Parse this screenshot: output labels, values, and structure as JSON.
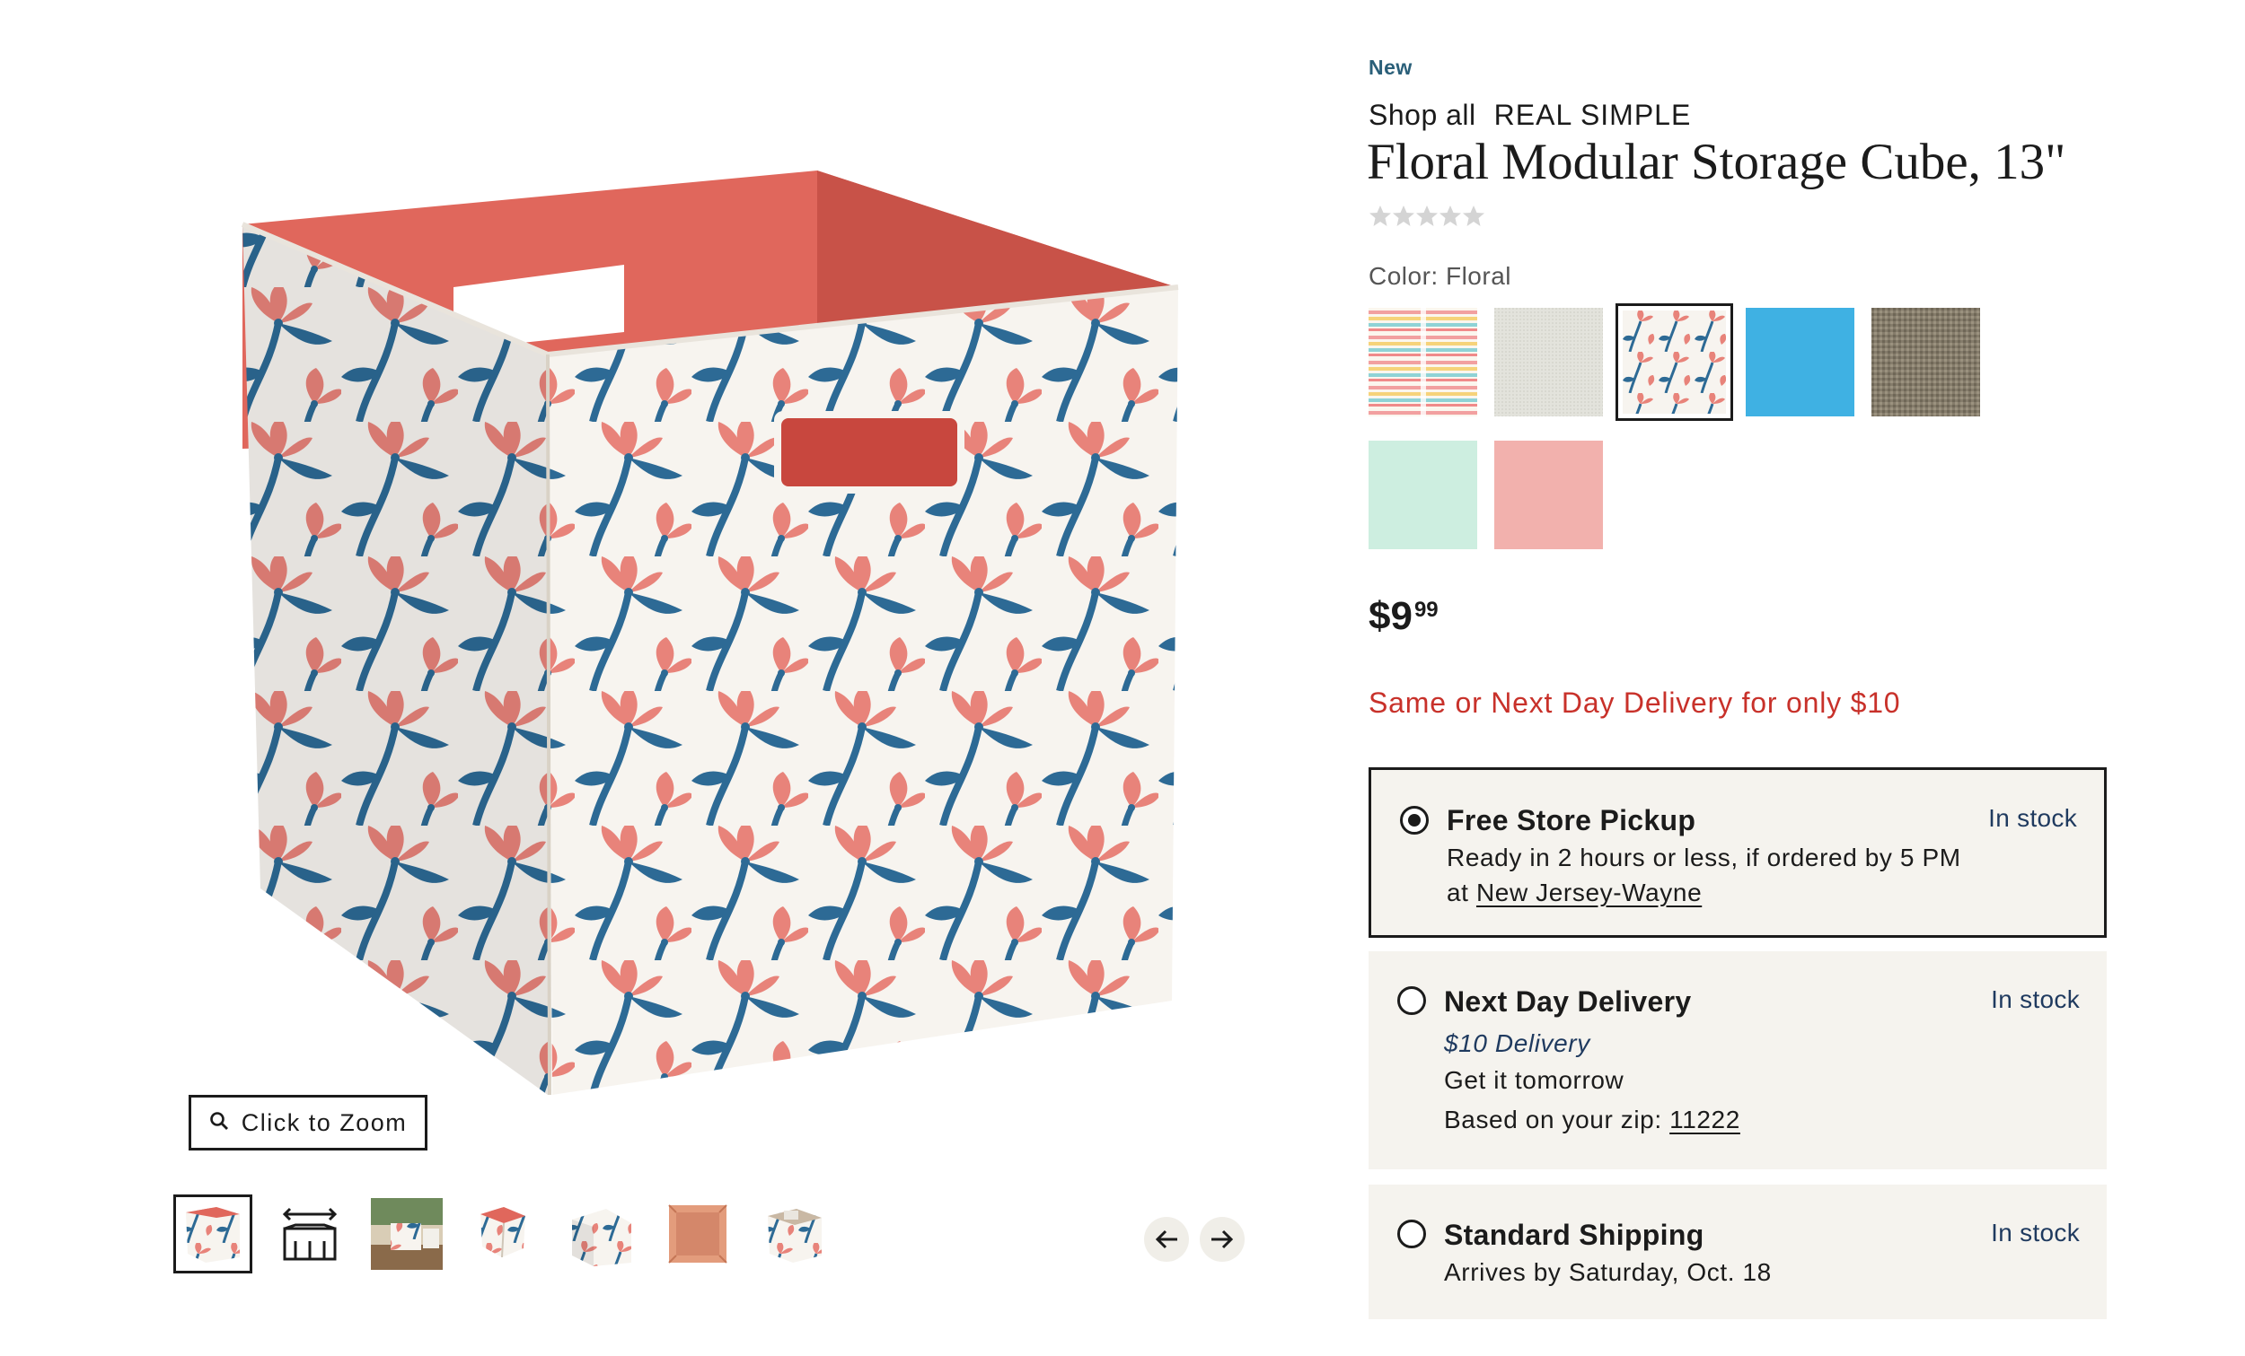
{
  "badge": "New",
  "shop_all": {
    "label": "Shop all",
    "brand": "REAL SIMPLE"
  },
  "product": {
    "title": "Floral Modular Storage Cube, 13\""
  },
  "color": {
    "label": "Color: Floral"
  },
  "swatches": [
    {
      "name": "stripe",
      "selected": false
    },
    {
      "name": "gray",
      "selected": false
    },
    {
      "name": "floral",
      "selected": true
    },
    {
      "name": "turquoise",
      "selected": false
    },
    {
      "name": "taupe",
      "selected": false
    },
    {
      "name": "mint",
      "selected": false
    },
    {
      "name": "blush",
      "selected": false
    }
  ],
  "price": {
    "dollars": "$9",
    "cents": "99"
  },
  "promo": "Same or Next Day Delivery for only $10",
  "fulfillment": {
    "pickup": {
      "title": "Free Store Pickup",
      "stock": "In stock",
      "line1": "Ready in 2 hours or less, if ordered by 5 PM",
      "at": "at",
      "store": "New Jersey-Wayne",
      "selected": true
    },
    "nextday": {
      "title": "Next Day Delivery",
      "stock": "In stock",
      "fee": "$10 Delivery",
      "line1": "Get it tomorrow",
      "zip_label": "Based on your zip:",
      "zip": "11222",
      "selected": false
    },
    "standard": {
      "title": "Standard Shipping",
      "stock": "In stock",
      "line1": "Arrives by Saturday, Oct. 18",
      "selected": false
    }
  },
  "gallery": {
    "zoom_label": "Click to Zoom",
    "thumbnail_count": 7,
    "selected_index": 0
  },
  "colors": {
    "promo_red": "#c8312a",
    "link_blue": "#1f3a5f",
    "badge_blue": "#2a5f79",
    "option_bg": "#f5f3ee",
    "floral_pink": "#e8837a",
    "floral_blue": "#2d6a95",
    "interior_coral": "#e0675c"
  }
}
